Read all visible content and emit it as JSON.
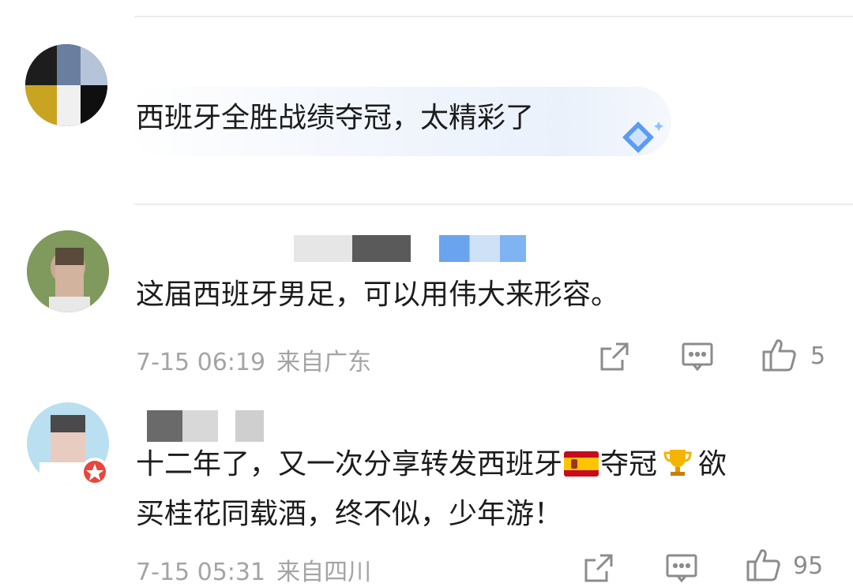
{
  "comments": [
    {
      "text": "西班牙全胜战绩夺冠，太精彩了",
      "has_badge": true
    },
    {
      "text": "这届西班牙男足，可以用伟大来形容。",
      "date": "7-15 06:19",
      "location": "来自广东",
      "likes": "5"
    },
    {
      "text_line1_a": "十二年了，又一次分享转发西班牙",
      "text_line1_b": "夺冠",
      "text_line1_c": "欲",
      "text_line2": "买桂花同载酒，终不似，少年游！",
      "date": "7-15 05:31",
      "location": "来自四川",
      "likes": "95"
    }
  ],
  "icons": {
    "forward": "share-icon",
    "comment": "comment-icon",
    "like": "thumbs-up-icon",
    "flag": "spain-flag-icon",
    "trophy": "trophy-icon",
    "badge": "diamond-badge-icon"
  },
  "colors": {
    "text": "#1c1c1c",
    "meta": "#a4a4a4",
    "icon": "#8c8c8c",
    "bubble": "#eaf1fb",
    "badge": "#4a8ff0"
  }
}
